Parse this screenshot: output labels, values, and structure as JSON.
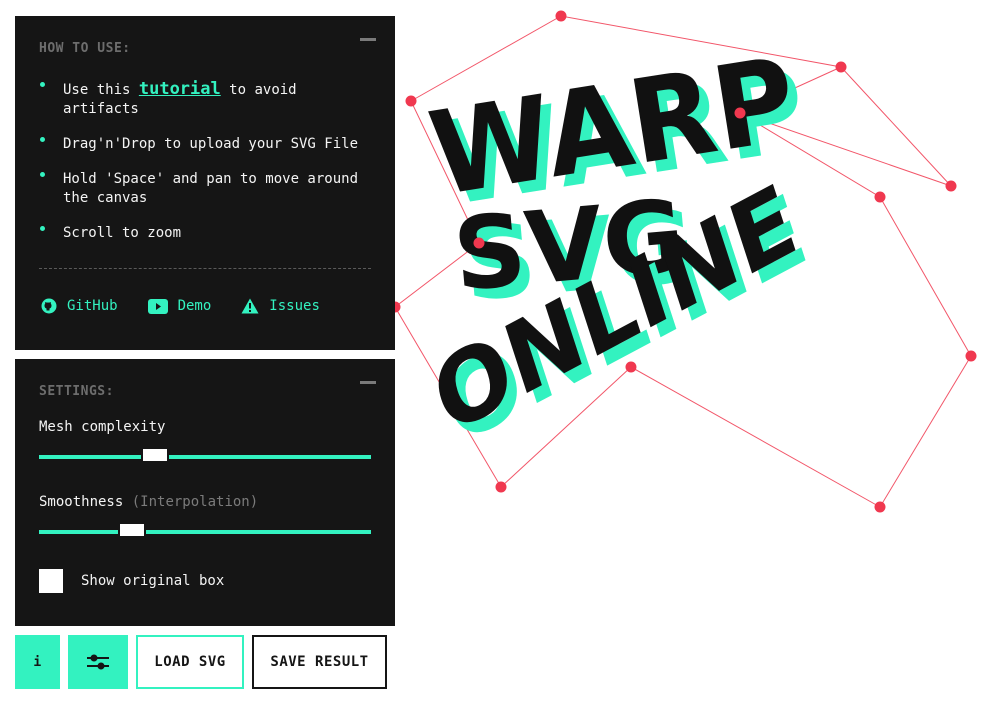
{
  "help": {
    "title": "HOW TO USE:",
    "items": [
      {
        "before": "Use this ",
        "link": "tutorial",
        "after": " to avoid artifacts"
      },
      {
        "text": "Drag'n'Drop to upload your SVG File"
      },
      {
        "text": "Hold 'Space' and pan to move around the canvas"
      },
      {
        "text": "Scroll to zoom"
      }
    ],
    "links": [
      {
        "label": "GitHub",
        "icon": "github-icon"
      },
      {
        "label": "Demo",
        "icon": "youtube-icon"
      },
      {
        "label": "Issues",
        "icon": "warning-icon"
      }
    ]
  },
  "settings": {
    "title": "SETTINGS:",
    "mesh_label": "Mesh complexity",
    "mesh_value": 0.35,
    "smooth_label": "Smoothness",
    "smooth_hint": "(Interpolation)",
    "smooth_value": 0.28,
    "show_box_label": "Show original box",
    "show_box_checked": false
  },
  "toolbar": {
    "info_label": "i",
    "settings_icon": "sliders-icon",
    "load_label": "LOAD SVG",
    "save_label": "SAVE RESULT"
  },
  "canvas": {
    "words": [
      "WARP",
      "SVG",
      "ONLINE"
    ],
    "accent_color": "#33f2c0",
    "handle_color": "#f0384f",
    "text_color": "#111111"
  }
}
